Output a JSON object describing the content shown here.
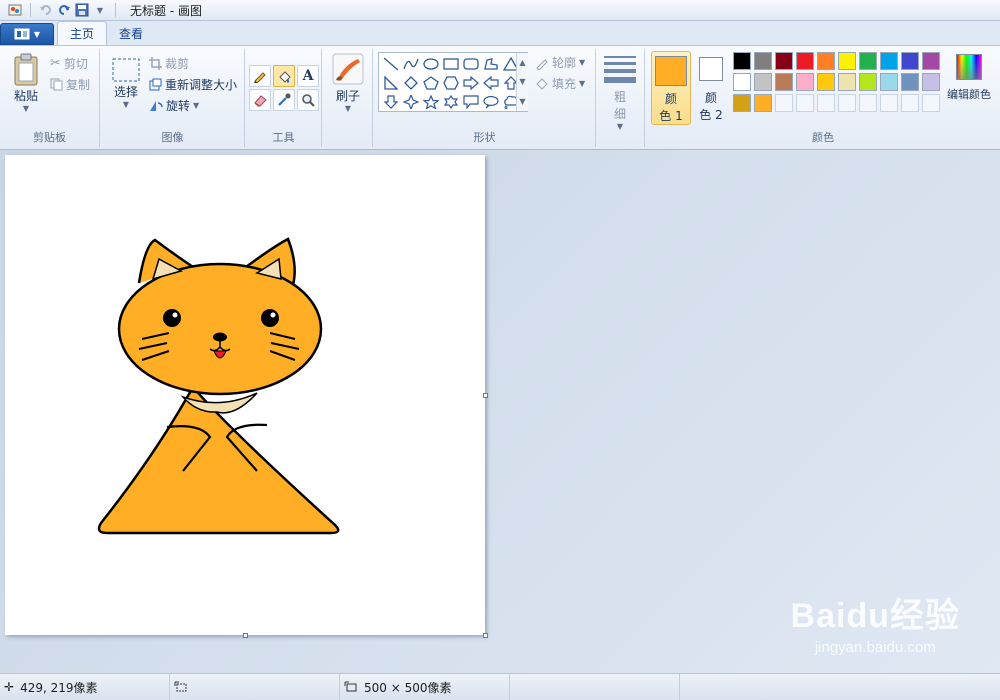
{
  "window": {
    "title": "无标题 - 画图"
  },
  "tabs": [
    {
      "label": "主页"
    },
    {
      "label": "查看"
    }
  ],
  "clipboard": {
    "paste_label": "粘贴",
    "cut_label": "剪切",
    "copy_label": "复制",
    "group_label": "剪贴板"
  },
  "image": {
    "select_label": "选择",
    "crop_label": "裁剪",
    "resize_label": "重新调整大小",
    "rotate_label": "旋转",
    "group_label": "图像"
  },
  "tools": {
    "group_label": "工具",
    "selected_tool": "fill-bucket"
  },
  "brushes": {
    "label": "刷子"
  },
  "shapes": {
    "outline_label": "轮廓",
    "fill_label": "填充",
    "group_label": "形状"
  },
  "size": {
    "label_line1": "粗",
    "label_line2": "细"
  },
  "colors": {
    "color1_label_line1": "颜",
    "color1_label_line2": "色 1",
    "color2_label_line1": "颜",
    "color2_label_line2": "色 2",
    "color1": "#ffae26",
    "color2": "#ffffff",
    "edit_label": "编辑颜色",
    "group_label": "颜色",
    "palette": [
      "#000000",
      "#7f7f7f",
      "#880015",
      "#ed1c24",
      "#ff7f27",
      "#fff200",
      "#22b14c",
      "#00a2e8",
      "#3f48cc",
      "#a349a4",
      "#ffffff",
      "#c3c3c3",
      "#b97a57",
      "#ffaec9",
      "#ffc90e",
      "#efe4b0",
      "#b5e61d",
      "#99d9ea",
      "#7092be",
      "#c8bfe7",
      "#d4a017",
      "#ffae26"
    ]
  },
  "status": {
    "cursor_pos": "429, 219像素",
    "selection_size": "",
    "canvas_size": "500 × 500像素"
  },
  "watermark": {
    "main": "Baidu经验",
    "sub": "jingyan.baidu.com"
  }
}
